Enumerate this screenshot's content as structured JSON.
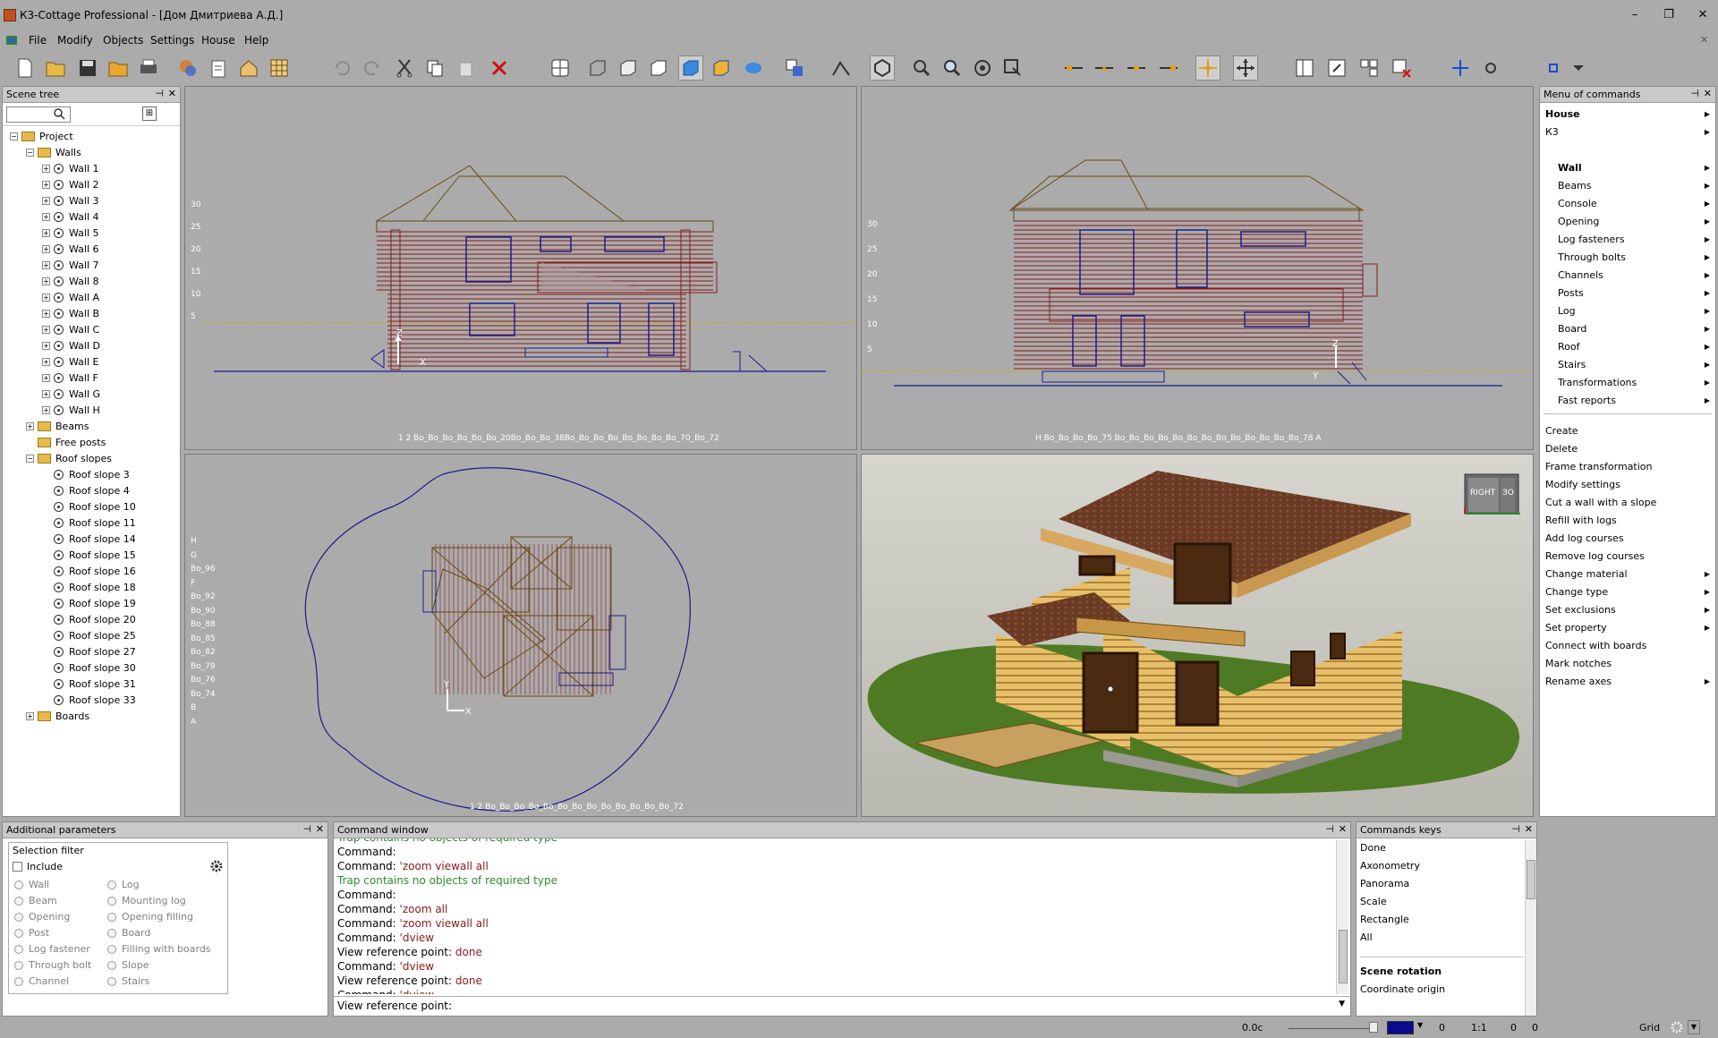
{
  "window": {
    "title": "К3-Cottage Professional - [Дом Дмитриева А.Д.]",
    "minimize": "–",
    "restore": "❐",
    "close": "✕"
  },
  "menubar": [
    "File",
    "Modify",
    "Objects",
    "Settings",
    "House",
    "Help"
  ],
  "scene_tree": {
    "title": "Scene tree",
    "search_placeholder": "",
    "project": "Project",
    "walls_group": "Walls",
    "walls": [
      "Wall 1",
      "Wall 2",
      "Wall 3",
      "Wall 4",
      "Wall 5",
      "Wall 6",
      "Wall 7",
      "Wall 8",
      "Wall A",
      "Wall B",
      "Wall C",
      "Wall D",
      "Wall E",
      "Wall F",
      "Wall G",
      "Wall H"
    ],
    "beams": "Beams",
    "free_posts": "Free posts",
    "roof_group": "Roof slopes",
    "roofs": [
      "Roof slope 3",
      "Roof slope 4",
      "Roof slope 10",
      "Roof slope 11",
      "Roof slope 14",
      "Roof slope 15",
      "Roof slope 16",
      "Roof slope 18",
      "Roof slope 19",
      "Roof slope 20",
      "Roof slope 25",
      "Roof slope 27",
      "Roof slope 30",
      "Roof slope 31",
      "Roof slope 33"
    ],
    "boards": "Boards"
  },
  "viewports": {
    "front": {
      "vticks": [
        "30",
        "25",
        "20",
        "15",
        "10",
        "5"
      ],
      "hticks": "1   2  Bo_Bo_Bo_Bo_Bo_Bo_20Bo_Bo_Bo_38Bo_Bo_Bo_Bo_Bo_Bo_Bo_Bo_70_Bo_72"
    },
    "side": {
      "vticks": [
        "30",
        "25",
        "20",
        "15",
        "10",
        "5"
      ],
      "hticks": "H   Bo_Bo_Bo_Bo_75   Bo_Bo_Bo_Bo_Bo_Bo_Bo_Bo_Bo_Bo_Bo_Bo_Bo_78   A"
    },
    "plan": {
      "vticks": [
        "H",
        "G",
        "Bo_96",
        "F",
        "Bo_92",
        "Bo_90",
        "Bo_88",
        "Bo_85",
        "Bo_82",
        "Bo_79",
        "Bo_76",
        "Bo_74",
        "B",
        "A"
      ],
      "hticks": "1  2 Bo_Bo_Bo_Bo_Bo_Bo_Bo_Bo_Bo_Bo_Bo_Bo_Bo_72"
    },
    "cube_labels": [
      "RIGHT",
      "ЗО"
    ]
  },
  "menu_commands": {
    "title": "Menu of commands",
    "top": [
      "House",
      "К3"
    ],
    "sub": [
      "Wall",
      "Beams",
      "Console",
      "Opening",
      "Log fasteners",
      "Through bolts",
      "Channels",
      "Posts",
      "Log",
      "Board",
      "Roof",
      "Stairs",
      "Transformations",
      "Fast reports"
    ],
    "actions": [
      {
        "label": "Create",
        "arrow": false
      },
      {
        "label": "Delete",
        "arrow": false
      },
      {
        "label": "Frame transformation",
        "arrow": false
      },
      {
        "label": "Modify settings",
        "arrow": false
      },
      {
        "label": "Cut a wall with a slope",
        "arrow": false
      },
      {
        "label": "Refill with logs",
        "arrow": false
      },
      {
        "label": "Add log courses",
        "arrow": false
      },
      {
        "label": "Remove log courses",
        "arrow": false
      },
      {
        "label": "Change material",
        "arrow": true
      },
      {
        "label": "Change type",
        "arrow": true
      },
      {
        "label": "Set exclusions",
        "arrow": true
      },
      {
        "label": "Set property",
        "arrow": true
      },
      {
        "label": "Connect with boards",
        "arrow": false
      },
      {
        "label": "Mark notches",
        "arrow": false
      },
      {
        "label": "Rename axes",
        "arrow": true
      }
    ]
  },
  "additional_params": {
    "title": "Additional parameters",
    "filter": "Selection filter",
    "include": "Include",
    "left": [
      "Wall",
      "Beam",
      "Opening",
      "Post",
      "Log fastener",
      "Through bolt",
      "Channel"
    ],
    "right": [
      "Log",
      "Mounting log",
      "Opening filling",
      "Board",
      "Filling with boards",
      "Slope",
      "Stairs"
    ]
  },
  "command_window": {
    "title": "Command window",
    "lines": [
      {
        "a": "Trap contains no objects of required type",
        "b": "",
        "c": "#2e8b2e"
      },
      {
        "a": "Command:",
        "b": "",
        "c": ""
      },
      {
        "a": "Command: ",
        "b": "'zoom viewall all",
        "c": ""
      },
      {
        "a": "Trap contains no objects of required type",
        "b": "",
        "c": "#2e8b2e"
      },
      {
        "a": "Command:",
        "b": "",
        "c": ""
      },
      {
        "a": "Command: ",
        "b": "'zoom all",
        "c": ""
      },
      {
        "a": "Command: ",
        "b": "'zoom viewall all",
        "c": ""
      },
      {
        "a": "Command: ",
        "b": "'dview",
        "c": ""
      },
      {
        "a": "View reference point: ",
        "b": "done",
        "c": ""
      },
      {
        "a": "Command: ",
        "b": "'dview",
        "c": ""
      },
      {
        "a": "View reference point: ",
        "b": "done",
        "c": ""
      },
      {
        "a": "Command: ",
        "b": "'dview",
        "c": ""
      }
    ],
    "prompt": "View reference point:"
  },
  "commands_keys": {
    "title": "Commands keys",
    "items": [
      "Done",
      "Axonometry",
      "Panorama",
      "Scale",
      "Rectangle",
      "All"
    ],
    "section": "Scene rotation",
    "sub": "Coordinate origin"
  },
  "status": {
    "coord": "0.0с",
    "v1": "0",
    "scale": "1:1",
    "v2": "0",
    "v3": "0",
    "grid": "Grid"
  },
  "colors": {
    "accent": "#0a0a8c",
    "wall": "#8b1a1a",
    "window": "#1c1c8c"
  }
}
